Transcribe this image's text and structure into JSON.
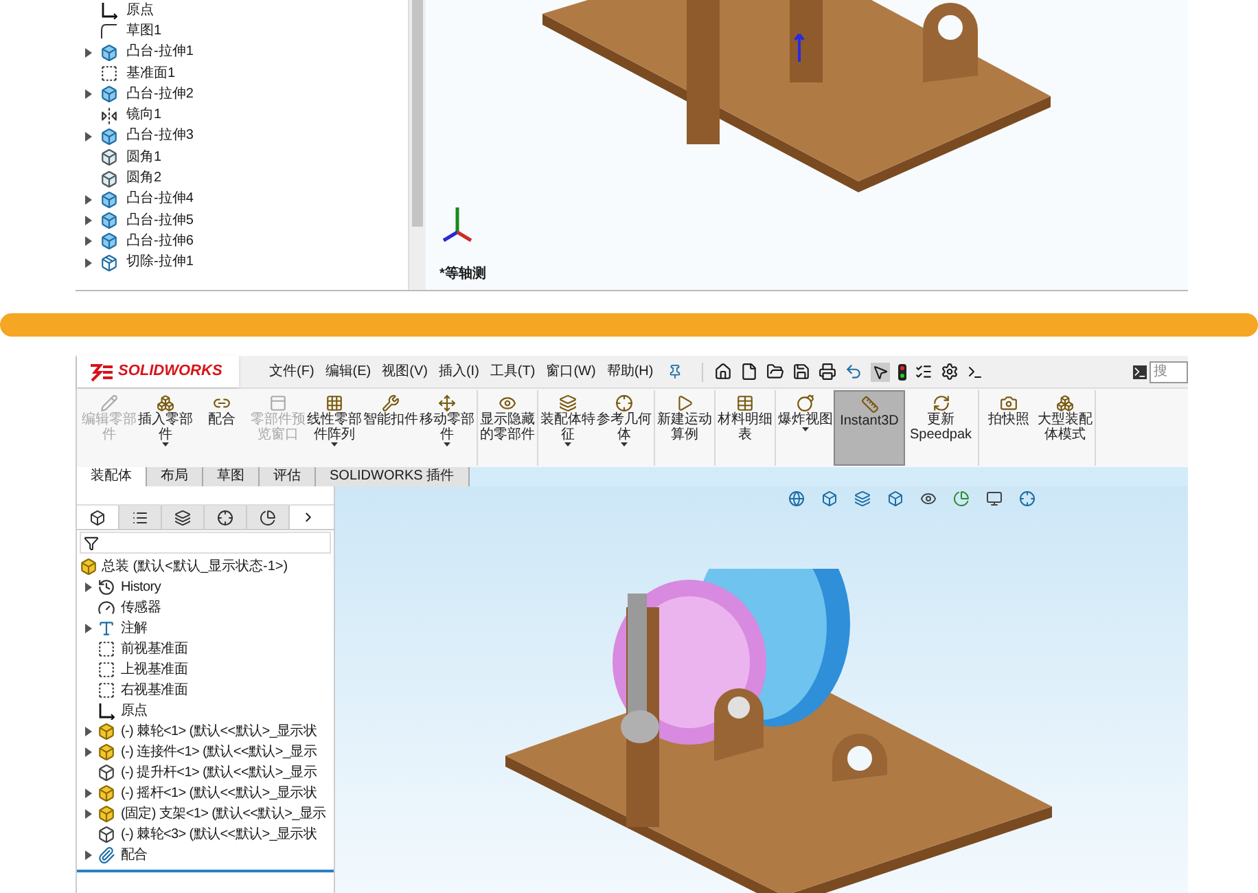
{
  "top_panel": {
    "tree": [
      {
        "label": "原点",
        "kind": "origin",
        "expandable": false
      },
      {
        "label": "草图1",
        "kind": "sketch",
        "expandable": false
      },
      {
        "label": "凸台-拉伸1",
        "kind": "extrude",
        "expandable": true
      },
      {
        "label": "基准面1",
        "kind": "plane",
        "expandable": false
      },
      {
        "label": "凸台-拉伸2",
        "kind": "extrude",
        "expandable": true
      },
      {
        "label": "镜向1",
        "kind": "mirror",
        "expandable": false
      },
      {
        "label": "凸台-拉伸3",
        "kind": "extrude",
        "expandable": true
      },
      {
        "label": "圆角1",
        "kind": "fillet",
        "expandable": false
      },
      {
        "label": "圆角2",
        "kind": "fillet",
        "expandable": false
      },
      {
        "label": "凸台-拉伸4",
        "kind": "extrude",
        "expandable": true
      },
      {
        "label": "凸台-拉伸5",
        "kind": "extrude",
        "expandable": true
      },
      {
        "label": "凸台-拉伸6",
        "kind": "extrude",
        "expandable": true
      },
      {
        "label": "切除-拉伸1",
        "kind": "cut",
        "expandable": true
      }
    ],
    "view_label": "*等轴测"
  },
  "bottom_window": {
    "logo": "SOLIDWORKS",
    "menu": [
      "文件(F)",
      "编辑(E)",
      "视图(V)",
      "插入(I)",
      "工具(T)",
      "窗口(W)",
      "帮助(H)"
    ],
    "search": {
      "placeholder": "搜"
    },
    "ribbon_groups": [
      [
        {
          "label": "编辑零部件",
          "disabled": true,
          "has_menu": false,
          "selected": false
        },
        {
          "label": "插入零部件",
          "disabled": false,
          "has_menu": true,
          "selected": false
        },
        {
          "label": "配合",
          "disabled": false,
          "has_menu": false,
          "selected": false
        },
        {
          "label": "零部件预览窗口",
          "disabled": true,
          "has_menu": false,
          "selected": false
        },
        {
          "label": "线性零部件阵列",
          "disabled": false,
          "has_menu": true,
          "selected": false
        },
        {
          "label": "智能扣件",
          "disabled": false,
          "has_menu": false,
          "selected": false
        },
        {
          "label": "移动零部件",
          "disabled": false,
          "has_menu": true,
          "selected": false
        }
      ],
      [
        {
          "label": "显示隐藏的零部件",
          "disabled": false,
          "has_menu": false,
          "selected": false
        }
      ],
      [
        {
          "label": "装配体特征",
          "disabled": false,
          "has_menu": true,
          "selected": false
        },
        {
          "label": "参考几何体",
          "disabled": false,
          "has_menu": true,
          "selected": false
        }
      ],
      [
        {
          "label": "新建运动算例",
          "disabled": false,
          "has_menu": false,
          "selected": false
        }
      ],
      [
        {
          "label": "材料明细表",
          "disabled": false,
          "has_menu": false,
          "selected": false
        }
      ],
      [
        {
          "label": "爆炸视图",
          "disabled": false,
          "has_menu": true,
          "selected": false
        },
        {
          "label": "Instant3D",
          "disabled": false,
          "has_menu": false,
          "selected": true
        },
        {
          "label": "更新 Speedpak",
          "disabled": false,
          "has_menu": false,
          "selected": false
        }
      ],
      [
        {
          "label": "拍快照",
          "disabled": false,
          "has_menu": false,
          "selected": false
        },
        {
          "label": "大型装配体模式",
          "disabled": false,
          "has_menu": false,
          "selected": false
        }
      ]
    ],
    "tabs": [
      {
        "label": "装配体",
        "selected": true
      },
      {
        "label": "布局",
        "selected": false
      },
      {
        "label": "草图",
        "selected": false
      },
      {
        "label": "评估",
        "selected": false
      },
      {
        "label": "SOLIDWORKS 插件",
        "selected": false
      }
    ],
    "panel_tabs": [
      {
        "selected": true
      },
      {
        "selected": false
      },
      {
        "selected": false
      },
      {
        "selected": false
      },
      {
        "selected": false
      }
    ],
    "tree": {
      "label": "总装  (默认<默认_显示状态-1>)",
      "children": [
        {
          "label": "History",
          "kind": "history",
          "expandable": true
        },
        {
          "label": "传感器",
          "kind": "sensor",
          "expandable": false
        },
        {
          "label": "注解",
          "kind": "annotation",
          "expandable": true
        },
        {
          "label": "前视基准面",
          "kind": "plane",
          "expandable": false
        },
        {
          "label": "上视基准面",
          "kind": "plane",
          "expandable": false
        },
        {
          "label": "右视基准面",
          "kind": "plane",
          "expandable": false
        },
        {
          "label": "原点",
          "kind": "origin",
          "expandable": false
        },
        {
          "label": "(-) 棘轮<1> (默认<<默认>_显示状",
          "kind": "part",
          "expandable": true
        },
        {
          "label": "(-) 连接件<1> (默认<<默认>_显示",
          "kind": "part",
          "expandable": true
        },
        {
          "label": "(-) 提升杆<1> (默认<<默认>_显示",
          "kind": "part_outline",
          "expandable": false
        },
        {
          "label": "(-) 摇杆<1> (默认<<默认>_显示状",
          "kind": "part",
          "expandable": true
        },
        {
          "label": "(固定) 支架<1> (默认<<默认>_显示",
          "kind": "part",
          "expandable": true
        },
        {
          "label": "(-) 棘轮<3> (默认<<默认>_显示状",
          "kind": "part_outline",
          "expandable": false
        },
        {
          "label": "配合",
          "kind": "mates",
          "expandable": true
        }
      ]
    }
  }
}
